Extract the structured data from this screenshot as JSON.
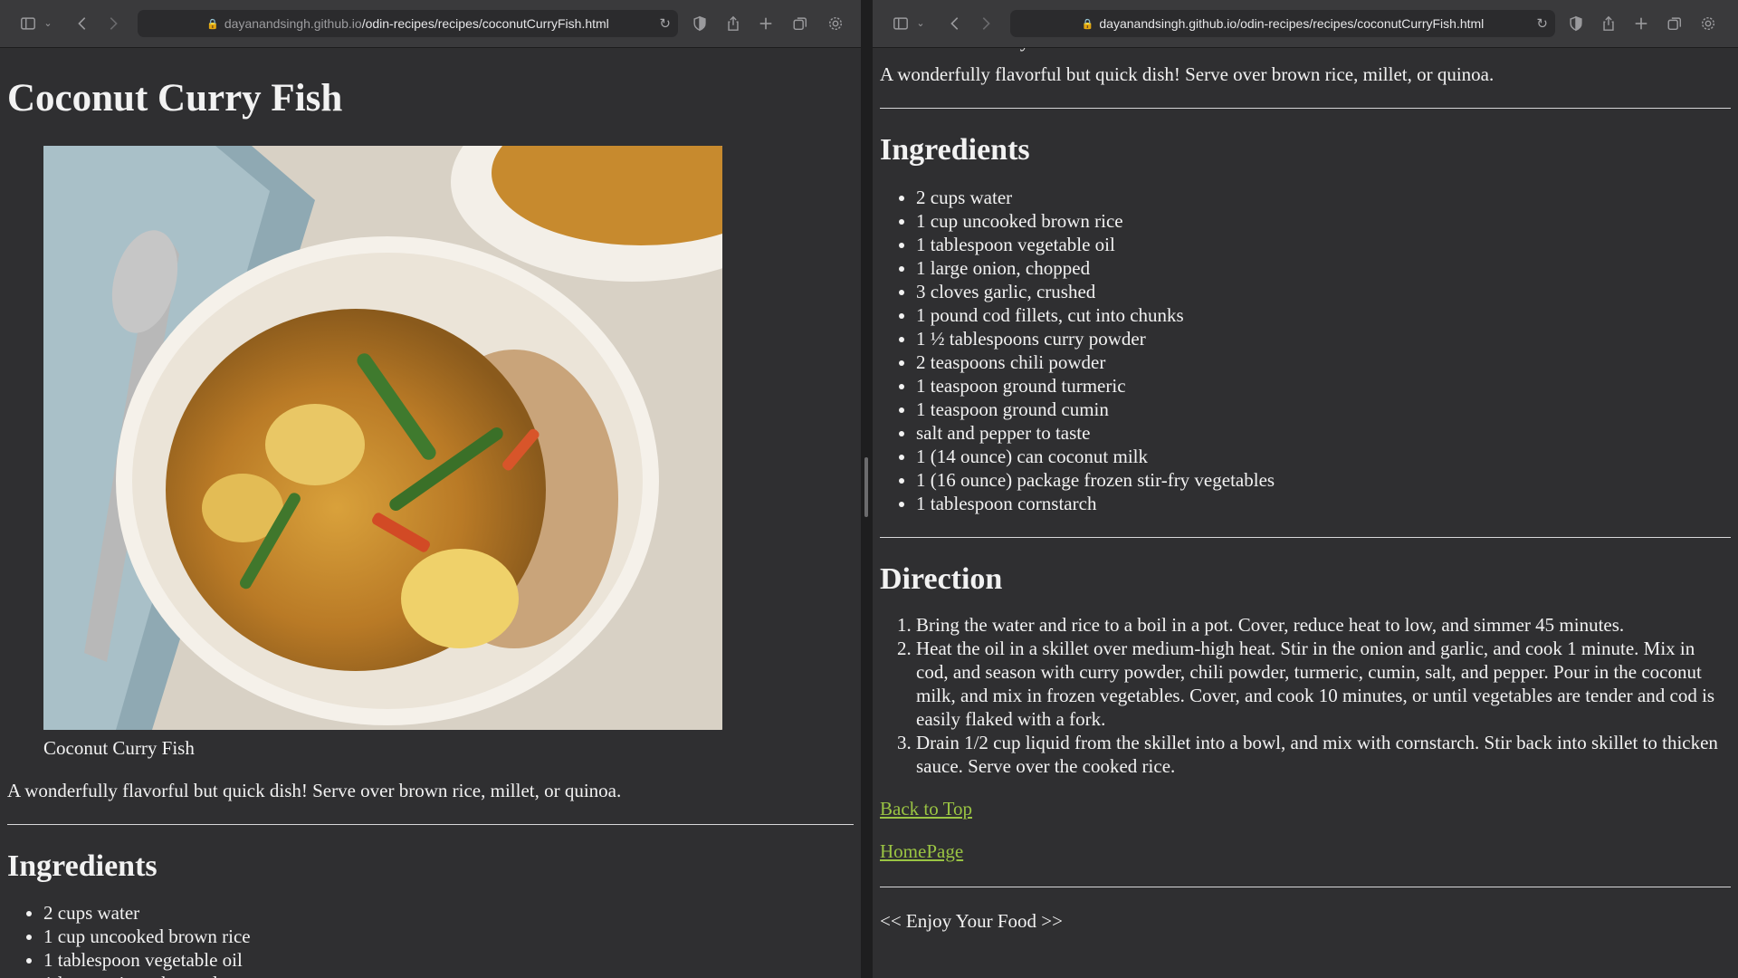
{
  "browser": {
    "url_domain": "dayanandsingh.github.io",
    "url_path": "/odin-recipes/recipes/coconutCurryFish.html"
  },
  "page": {
    "title": "Coconut Curry Fish",
    "image_caption": "Coconut Curry Fish",
    "intro": "A wonderfully flavorful but quick dish! Serve over brown rice, millet, or quinoa.",
    "ingredients_heading": "Ingredients",
    "ingredients": [
      "2 cups water",
      "1 cup uncooked brown rice",
      "1 tablespoon vegetable oil",
      "1 large onion, chopped",
      "3 cloves garlic, crushed",
      "1 pound cod fillets, cut into chunks",
      "1 ½ tablespoons curry powder",
      "2 teaspoons chili powder",
      "1 teaspoon ground turmeric",
      "1 teaspoon ground cumin",
      "salt and pepper to taste",
      "1 (14 ounce) can coconut milk",
      "1 (16 ounce) package frozen stir-fry vegetables",
      "1 tablespoon cornstarch"
    ],
    "direction_heading": "Direction",
    "directions": [
      "Bring the water and rice to a boil in a pot. Cover, reduce heat to low, and simmer 45 minutes.",
      "Heat the oil in a skillet over medium-high heat. Stir in the onion and garlic, and cook 1 minute. Mix in cod, and season with curry powder, chili powder, turmeric, cumin, salt, and pepper. Pour in the coconut milk, and mix in frozen vegetables. Cover, and cook 10 minutes, or until vegetables are tender and cod is easily flaked with a fork.",
      "Drain 1/2 cup liquid from the skillet into a bowl, and mix with cornstarch. Stir back into skillet to thicken sauce. Serve over the cooked rice."
    ],
    "back_to_top": "Back to Top",
    "homepage": "HomePage",
    "footer": "<< Enjoy Your Food >>"
  },
  "colors": {
    "page_bg": "#2f2f31",
    "toolbar_bg": "#3a3a3c",
    "link": "#9ac443",
    "text": "#f2f2f2"
  },
  "icons": [
    "sidebar-icon",
    "chevron-down-icon",
    "back-icon",
    "forward-icon",
    "lock-icon",
    "reload-icon",
    "shield-icon",
    "share-icon",
    "new-tab-icon",
    "tabs-overview-icon",
    "gear-icon"
  ]
}
